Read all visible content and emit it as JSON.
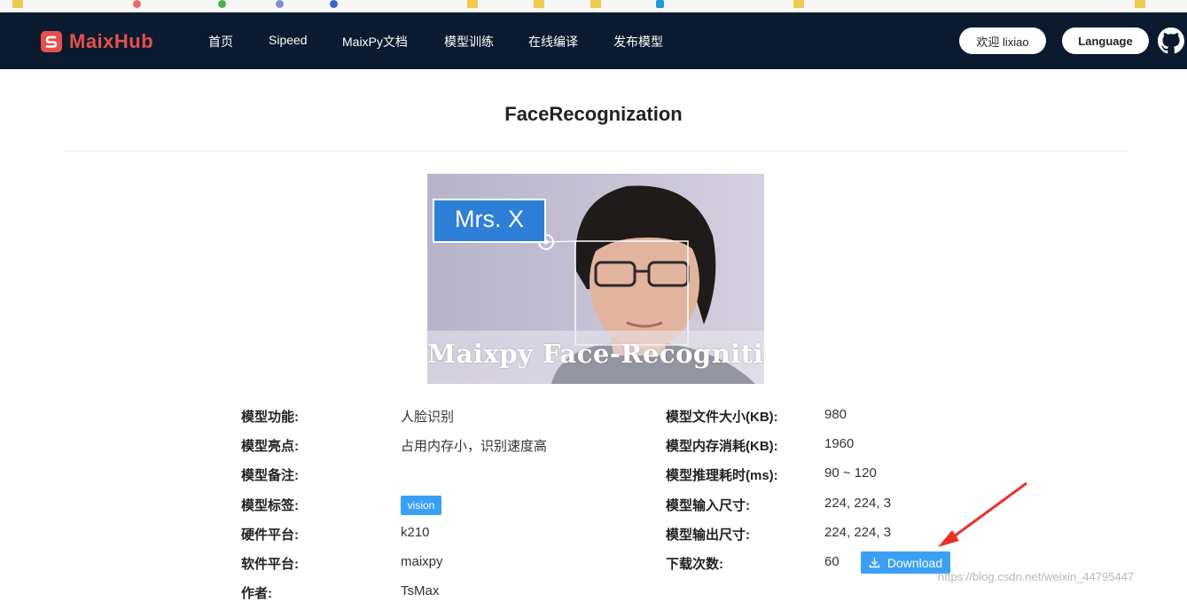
{
  "navbar": {
    "logo_text": "MaixHub",
    "items": [
      "首页",
      "Sipeed",
      "MaixPy文档",
      "模型训练",
      "在线编译",
      "发布模型"
    ],
    "welcome": "欢迎 lixiao",
    "language": "Language"
  },
  "page": {
    "title": "FaceRecognization"
  },
  "hero": {
    "label": "Mrs. X",
    "caption": "Maixpy Face-Recognition"
  },
  "details_left": [
    {
      "label": "模型功能:",
      "value": "人脸识别"
    },
    {
      "label": "模型亮点:",
      "value": "占用内存小，识别速度高"
    },
    {
      "label": "模型备注:",
      "value": ""
    },
    {
      "label": "模型标签:",
      "tag": "vision"
    },
    {
      "label": "硬件平台:",
      "value": "k210"
    },
    {
      "label": "软件平台:",
      "value": "maixpy"
    },
    {
      "label": "作者:",
      "value": "TsMax"
    }
  ],
  "details_right": [
    {
      "label": "模型文件大小(KB):",
      "value": "980"
    },
    {
      "label": "模型内存消耗(KB):",
      "value": "1960"
    },
    {
      "label": "模型推理耗时(ms):",
      "value": "90 ~ 120"
    },
    {
      "label": "模型输入尺寸:",
      "value": "224, 224, 3"
    },
    {
      "label": "模型输出尺寸:",
      "value": "224, 224, 3"
    },
    {
      "label": "下载次数:",
      "value": "60"
    }
  ],
  "download": {
    "label": "Download"
  },
  "watermark": "https://blog.csdn.net/weixin_44795447",
  "colors": {
    "navbar": "#0b1a2e",
    "brand": "#e5514a",
    "accent": "#3aa0f5",
    "arrow": "#e8312c"
  }
}
